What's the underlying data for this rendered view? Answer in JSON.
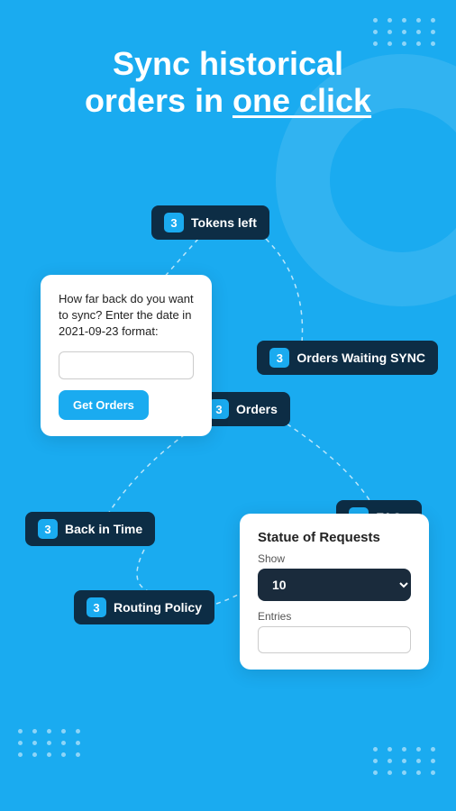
{
  "hero": {
    "line1": "Sync historical",
    "line2": "orders in ",
    "line2_highlight": "one click"
  },
  "badges": {
    "tokens_left": {
      "num": "3",
      "label": "Tokens left"
    },
    "orders_waiting": {
      "num": "3",
      "label": "Orders Waiting SYNC"
    },
    "orders": {
      "num": "3",
      "label": "Orders"
    },
    "back_in_time": {
      "num": "3",
      "label": "Back in Time"
    },
    "faqs": {
      "num": "3",
      "label": "FAQs"
    },
    "routing_policy": {
      "num": "3",
      "label": "Routing Policy"
    }
  },
  "form_card": {
    "description": "How far back do you want to sync? Enter the date in 2021-09-23 format:",
    "input_placeholder": "",
    "button_label": "Get Orders"
  },
  "status_card": {
    "title": "Statue of Requests",
    "show_label": "Show",
    "show_value": "10",
    "entries_label": "Entries"
  },
  "dots": {
    "count": 15
  }
}
